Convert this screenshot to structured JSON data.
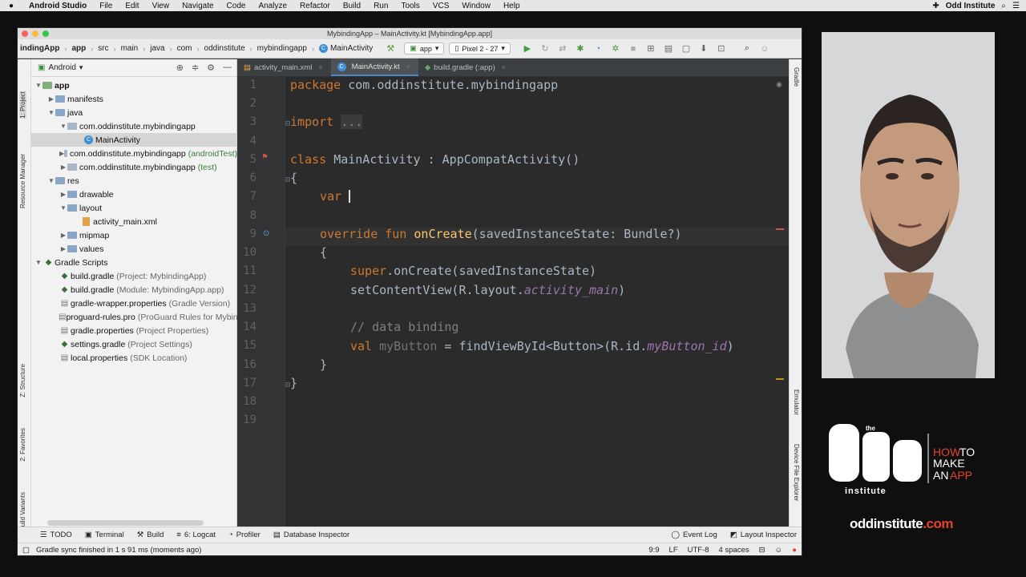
{
  "menubar": {
    "app_name": "Android Studio",
    "items": [
      "File",
      "Edit",
      "View",
      "Navigate",
      "Code",
      "Analyze",
      "Refactor",
      "Build",
      "Run",
      "Tools",
      "VCS",
      "Window",
      "Help"
    ],
    "right_label": "Odd Institute"
  },
  "window": {
    "title": "MybindingApp – MainActivity.kt [MybindingApp.app]"
  },
  "navbar": {
    "breadcrumbs": [
      "indingApp",
      "app",
      "src",
      "main",
      "java",
      "com",
      "oddinstitute",
      "mybindingapp",
      "MainActivity"
    ],
    "run_config": "app",
    "device": "Pixel 2 - 27"
  },
  "project_panel": {
    "view_mode": "Android",
    "tree": [
      {
        "label": "app",
        "note": ""
      },
      {
        "label": "manifests",
        "note": ""
      },
      {
        "label": "java",
        "note": ""
      },
      {
        "label": "com.oddinstitute.mybindingapp",
        "note": ""
      },
      {
        "label": "MainActivity",
        "note": ""
      },
      {
        "label": "com.oddinstitute.mybindingapp",
        "note": "(androidTest)"
      },
      {
        "label": "com.oddinstitute.mybindingapp",
        "note": "(test)"
      },
      {
        "label": "res",
        "note": ""
      },
      {
        "label": "drawable",
        "note": ""
      },
      {
        "label": "layout",
        "note": ""
      },
      {
        "label": "activity_main.xml",
        "note": ""
      },
      {
        "label": "mipmap",
        "note": ""
      },
      {
        "label": "values",
        "note": ""
      },
      {
        "label": "Gradle Scripts",
        "note": ""
      },
      {
        "label": "build.gradle",
        "note": "(Project: MybindingApp)"
      },
      {
        "label": "build.gradle",
        "note": "(Module: MybindingApp.app)"
      },
      {
        "label": "gradle-wrapper.properties",
        "note": "(Gradle Version)"
      },
      {
        "label": "proguard-rules.pro",
        "note": "(ProGuard Rules for MybindingApp.app)"
      },
      {
        "label": "gradle.properties",
        "note": "(Project Properties)"
      },
      {
        "label": "settings.gradle",
        "note": "(Project Settings)"
      },
      {
        "label": "local.properties",
        "note": "(SDK Location)"
      }
    ]
  },
  "left_stripe": [
    "1: Project",
    "Resource Manager",
    "Z: Structure",
    "2: Favorites",
    "Build Variants"
  ],
  "right_stripe": [
    "Gradle",
    "Emulator",
    "Device File Explorer"
  ],
  "editor": {
    "tabs": [
      "activity_main.xml",
      "MainActivity.kt",
      "build.gradle (:app)"
    ],
    "active_tab": "MainActivity.kt",
    "line_numbers": [
      "1",
      "2",
      "3",
      "4",
      "5",
      "6",
      "7",
      "8",
      "9",
      "10",
      "11",
      "12",
      "13",
      "14",
      "15",
      "16",
      "17",
      "18",
      "19"
    ],
    "code": {
      "package_kw": "package",
      "package_name": "com.oddinstitute.mybindingapp",
      "import_kw": "import",
      "import_fold": "...",
      "class_kw": "class",
      "class_decl": "MainActivity : AppCompatActivity()",
      "open_brace": "{",
      "var_kw": "var",
      "override_kw": "override fun",
      "on_create": "onCreate",
      "on_create_params": "(savedInstanceState: Bundle?)",
      "super_kw": "super",
      "super_call": ".onCreate(savedInstanceState)",
      "set_content": "setContentView(R.layout.",
      "layout_ref": "activity_main",
      "close_paren": ")",
      "comment": "// data binding",
      "val_kw": "val",
      "val_name": "myButton",
      "find_view": " = findViewById<Button>(R.id.",
      "id_ref": "myButton_id",
      "close_brace": "}"
    }
  },
  "tool_windows": {
    "left": [
      "TODO",
      "Terminal",
      "Build",
      "6: Logcat",
      "Profiler",
      "Database Inspector"
    ],
    "right": [
      "Event Log",
      "Layout Inspector"
    ]
  },
  "status": {
    "message": "Gradle sync finished in 1 s 91 ms (moments ago)",
    "position": "9:9",
    "line_sep": "LF",
    "encoding": "UTF-8",
    "indent": "4 spaces"
  },
  "branding": {
    "logo_top": "the",
    "logo_bottom": "institute",
    "how": "HOW",
    "to": "TO",
    "make": "MAKE",
    "an": "AN",
    "app": "APP",
    "site_main": "oddinstitute",
    "site_dot": ".com"
  }
}
